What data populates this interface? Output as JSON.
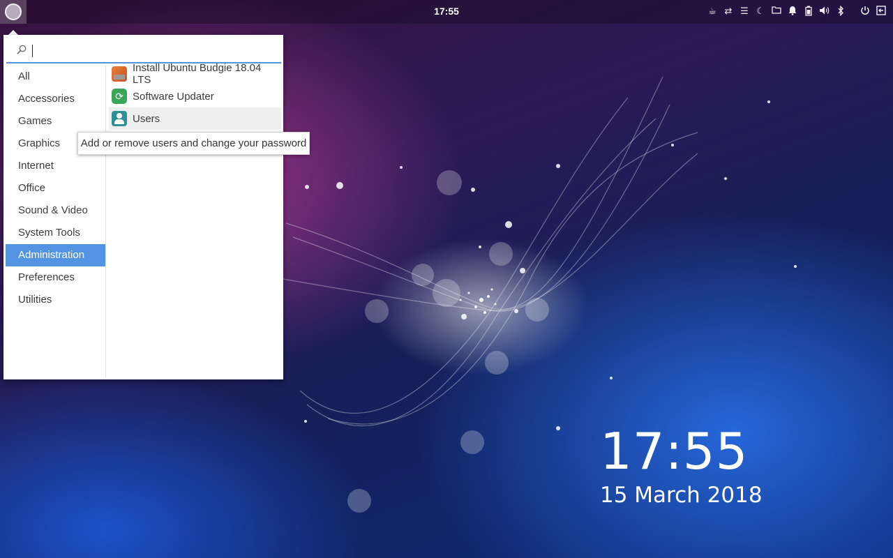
{
  "panel": {
    "clock": "17:55",
    "tray_icons": [
      "coffee-icon",
      "network-icon",
      "menu-lines-icon",
      "night-light-icon",
      "folder-icon",
      "notifications-icon",
      "battery-icon",
      "volume-icon",
      "bluetooth-icon",
      "power-icon",
      "logout-icon"
    ]
  },
  "menu": {
    "search": {
      "value": "",
      "placeholder": ""
    },
    "categories": [
      {
        "label": "All"
      },
      {
        "label": "Accessories"
      },
      {
        "label": "Games"
      },
      {
        "label": "Graphics"
      },
      {
        "label": "Internet"
      },
      {
        "label": "Office"
      },
      {
        "label": "Sound & Video"
      },
      {
        "label": "System Tools"
      },
      {
        "label": "Administration",
        "selected": true
      },
      {
        "label": "Preferences"
      },
      {
        "label": "Utilities"
      }
    ],
    "apps": [
      {
        "label": "Install Ubuntu Budgie 18.04 LTS",
        "icon": "installer-icon"
      },
      {
        "label": "Software Updater",
        "icon": "software-updater-icon"
      },
      {
        "label": "Users",
        "icon": "users-icon"
      }
    ],
    "tooltip": "Add or remove users and change your password",
    "accent_color": "#5294e2"
  },
  "desktop": {
    "time": "17:55",
    "date": "15 March 2018"
  }
}
